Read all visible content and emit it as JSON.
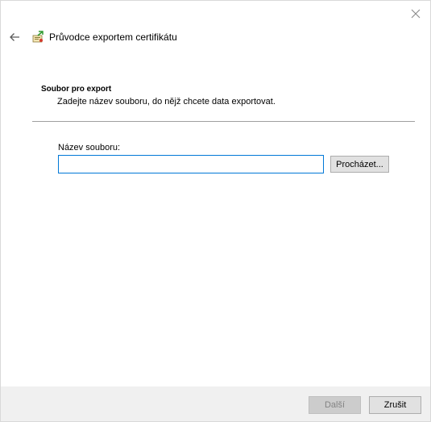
{
  "window": {
    "title": "Průvodce exportem certifikátu",
    "close_icon": "close-icon",
    "back_icon": "back-arrow-icon",
    "wizard_icon": "certificate-wizard-icon"
  },
  "section": {
    "title": "Soubor pro export",
    "description": "Zadejte název souboru, do nějž chcete data exportovat."
  },
  "form": {
    "file_label": "Název souboru:",
    "file_value": "",
    "browse_label": "Procházet..."
  },
  "footer": {
    "next_label": "Další",
    "next_enabled": false,
    "cancel_label": "Zrušit"
  },
  "colors": {
    "input_border_focus": "#0078d7",
    "footer_bg": "#f0f0f0",
    "button_bg": "#e1e1e1"
  }
}
